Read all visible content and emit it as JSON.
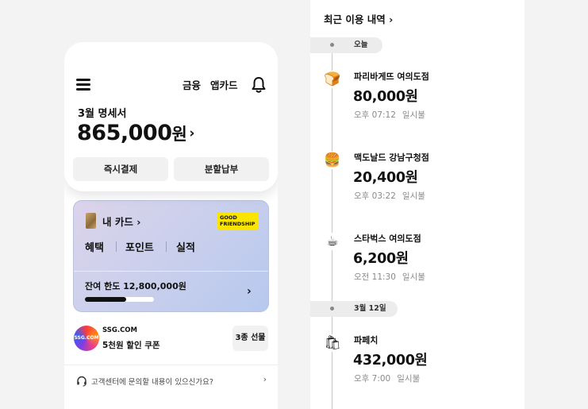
{
  "app": {
    "header": {
      "menu_icon": "hamburger-icon",
      "links": [
        "금융",
        "앱카드"
      ],
      "bell_icon": "bell-icon"
    },
    "statement": {
      "title": "3월 명세서",
      "amount": "865,000",
      "currency": "원",
      "chevron": "›",
      "buttons": [
        "즉시결제",
        "분할납부"
      ]
    },
    "card": {
      "label": "내 카드",
      "chevron": "›",
      "badge_line1": "GOOD",
      "badge_line2": "FRIENDSHIP",
      "tabs": [
        "혜택",
        "포인트",
        "실적"
      ],
      "limit_label": "잔여 한도 12,800,000원",
      "limit_progress": 0.6,
      "arrow": "›"
    },
    "promo": {
      "logo_text": "SSG.COM",
      "brand": "SSG.COM",
      "text": "5천원 할인 쿠폰",
      "button": "3종 선물"
    },
    "help": {
      "text": "고객센터에 문의할 내용이 있으신가요?",
      "icon": "headset-icon",
      "arrow": "›"
    },
    "colors": {
      "accent_yellow": "#fae500",
      "badge_text": "#111111"
    }
  },
  "history": {
    "title": "최근 이용 내역",
    "chevron": "›",
    "groups": [
      {
        "date": "오늘",
        "items": [
          {
            "icon": "bread-icon",
            "emoji": "🍞",
            "merchant": "파리바게뜨 여의도점",
            "amount": "80,000원",
            "time": "오후 07:12",
            "type": "일시불"
          },
          {
            "icon": "burger-icon",
            "emoji": "🍔",
            "merchant": "맥도날드 강남구청점",
            "amount": "20,400원",
            "time": "오후 03:22",
            "type": "일시불"
          },
          {
            "icon": "coffee-icon",
            "emoji": "☕",
            "merchant": "스타벅스 여의도점",
            "amount": "6,200원",
            "time": "오전 11:30",
            "type": "일시불"
          }
        ]
      },
      {
        "date": "3월 12일",
        "items": [
          {
            "icon": "shopping-bag-icon",
            "emoji": "🛍",
            "merchant": "파페치",
            "amount": "432,000원",
            "time": "오후 7:00",
            "type": "일시불"
          }
        ]
      }
    ]
  }
}
